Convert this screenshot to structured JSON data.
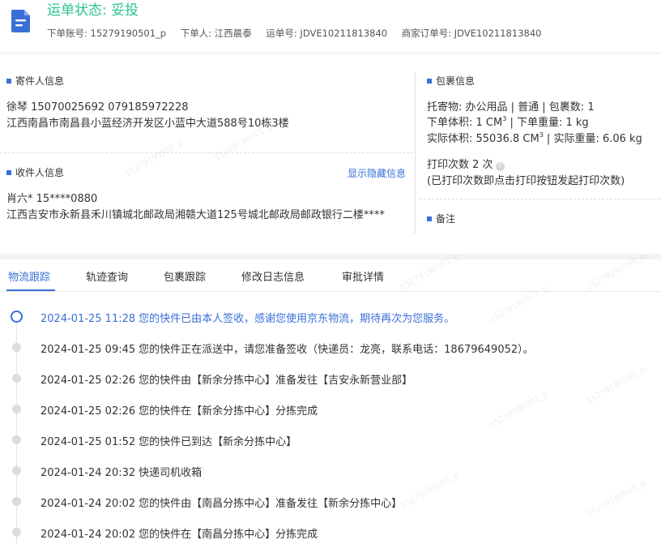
{
  "header": {
    "status_label": "运单状态:",
    "status_value": "妥投",
    "order_account": "下单账号: 15279190501_p",
    "orderer": "下单人: 江西晨泰",
    "waybill": "运单号: JDVE10211813840",
    "merchant_order": "商家订单号: JDVE10211813840"
  },
  "sender": {
    "title": "寄件人信息",
    "line1": "徐琴   15070025692   079185972228",
    "line2": "江西南昌市南昌县小蓝经济开发区小蓝中大道588号10栋3楼"
  },
  "receiver": {
    "title": "收件人信息",
    "toggle_link": "显示隐藏信息",
    "line1": "肖六*   15****0880",
    "line2": "江西吉安市永新县禾川镇城北邮政局湘赣大道125号城北邮政局邮政银行二楼****"
  },
  "package": {
    "title": "包裹信息",
    "line1": "托寄物:  办公用品 | 普通  | 包裹数:  1",
    "vol_label": "下单体积:  1 CM",
    "vol_sup": "3",
    "weight": " | 下单重量:  1 kg",
    "actual_vol_label": "实际体积:  55036.8 CM",
    "actual_vol_sup": "3",
    "actual_weight": " | 实际重量:  6.06 kg",
    "print_count": "打印次数   2 次",
    "print_note": "(已打印次数即点击打印按钮发起打印次数)"
  },
  "remarks": {
    "title": "备注"
  },
  "tabs": [
    "物流跟踪",
    "轨迹查询",
    "包裹跟踪",
    "修改日志信息",
    "审批详情"
  ],
  "timeline": [
    {
      "time": "2024-01-25 11:28",
      "text": "您的快件已由本人签收，感谢您使用京东物流，期待再次为您服务。"
    },
    {
      "time": "2024-01-25 09:45",
      "text": "您的快件正在派送中，请您准备签收（快递员：龙亮，联系电话：18679649052）。"
    },
    {
      "time": "2024-01-25 02:26",
      "text": "您的快件由【新余分拣中心】准备发往【吉安永新营业部】"
    },
    {
      "time": "2024-01-25 02:26",
      "text": "您的快件在【新余分拣中心】分拣完成"
    },
    {
      "time": "2024-01-25 01:52",
      "text": "您的快件已到达【新余分拣中心】"
    },
    {
      "time": "2024-01-24 20:32",
      "text": "快递司机收箱"
    },
    {
      "time": "2024-01-24 20:02",
      "text": "您的快件由【南昌分拣中心】准备发往【新余分拣中心】"
    },
    {
      "time": "2024-01-24 20:02",
      "text": "您的快件在【南昌分拣中心】分拣完成"
    }
  ],
  "watermark": "15279190501_p",
  "colors": {
    "accent": "#3a6fd8",
    "status_green": "#2bc48c"
  }
}
